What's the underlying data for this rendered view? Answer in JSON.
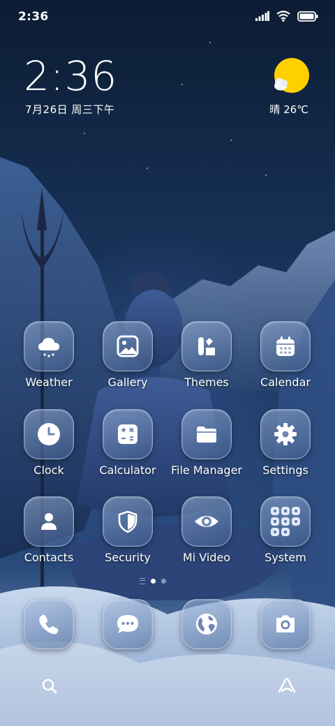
{
  "status_bar": {
    "time": "2:36",
    "icons": [
      "signal-icon",
      "wifi-icon",
      "battery-icon"
    ]
  },
  "clock_widget": {
    "time": "2:36",
    "date": "7月26日 周三下午"
  },
  "weather_widget": {
    "icon": "partly-sunny-icon",
    "text": "晴 26℃"
  },
  "apps": [
    {
      "label": "Weather",
      "icon": "cloud-icon"
    },
    {
      "label": "Gallery",
      "icon": "image-icon"
    },
    {
      "label": "Themes",
      "icon": "themes-icon"
    },
    {
      "label": "Calendar",
      "icon": "calendar-icon"
    },
    {
      "label": "Clock",
      "icon": "clock-icon"
    },
    {
      "label": "Calculator",
      "icon": "calculator-icon"
    },
    {
      "label": "File Manager",
      "icon": "folder-icon"
    },
    {
      "label": "Settings",
      "icon": "gear-icon"
    },
    {
      "label": "Contacts",
      "icon": "person-icon"
    },
    {
      "label": "Security",
      "icon": "shield-icon"
    },
    {
      "label": "Mi Video",
      "icon": "eye-icon"
    },
    {
      "label": "System",
      "icon": "folder-grid-icon"
    }
  ],
  "pager": {
    "pages": 2,
    "current": 1
  },
  "dock": [
    {
      "icon": "phone-icon"
    },
    {
      "icon": "message-icon"
    },
    {
      "icon": "globe-icon"
    },
    {
      "icon": "camera-icon"
    }
  ],
  "bottom_bar": {
    "left_icon": "search-icon",
    "right_icon": "assistant-icon"
  },
  "colors": {
    "sun": "#ffd000",
    "tile_border": "#d2e1fa"
  }
}
